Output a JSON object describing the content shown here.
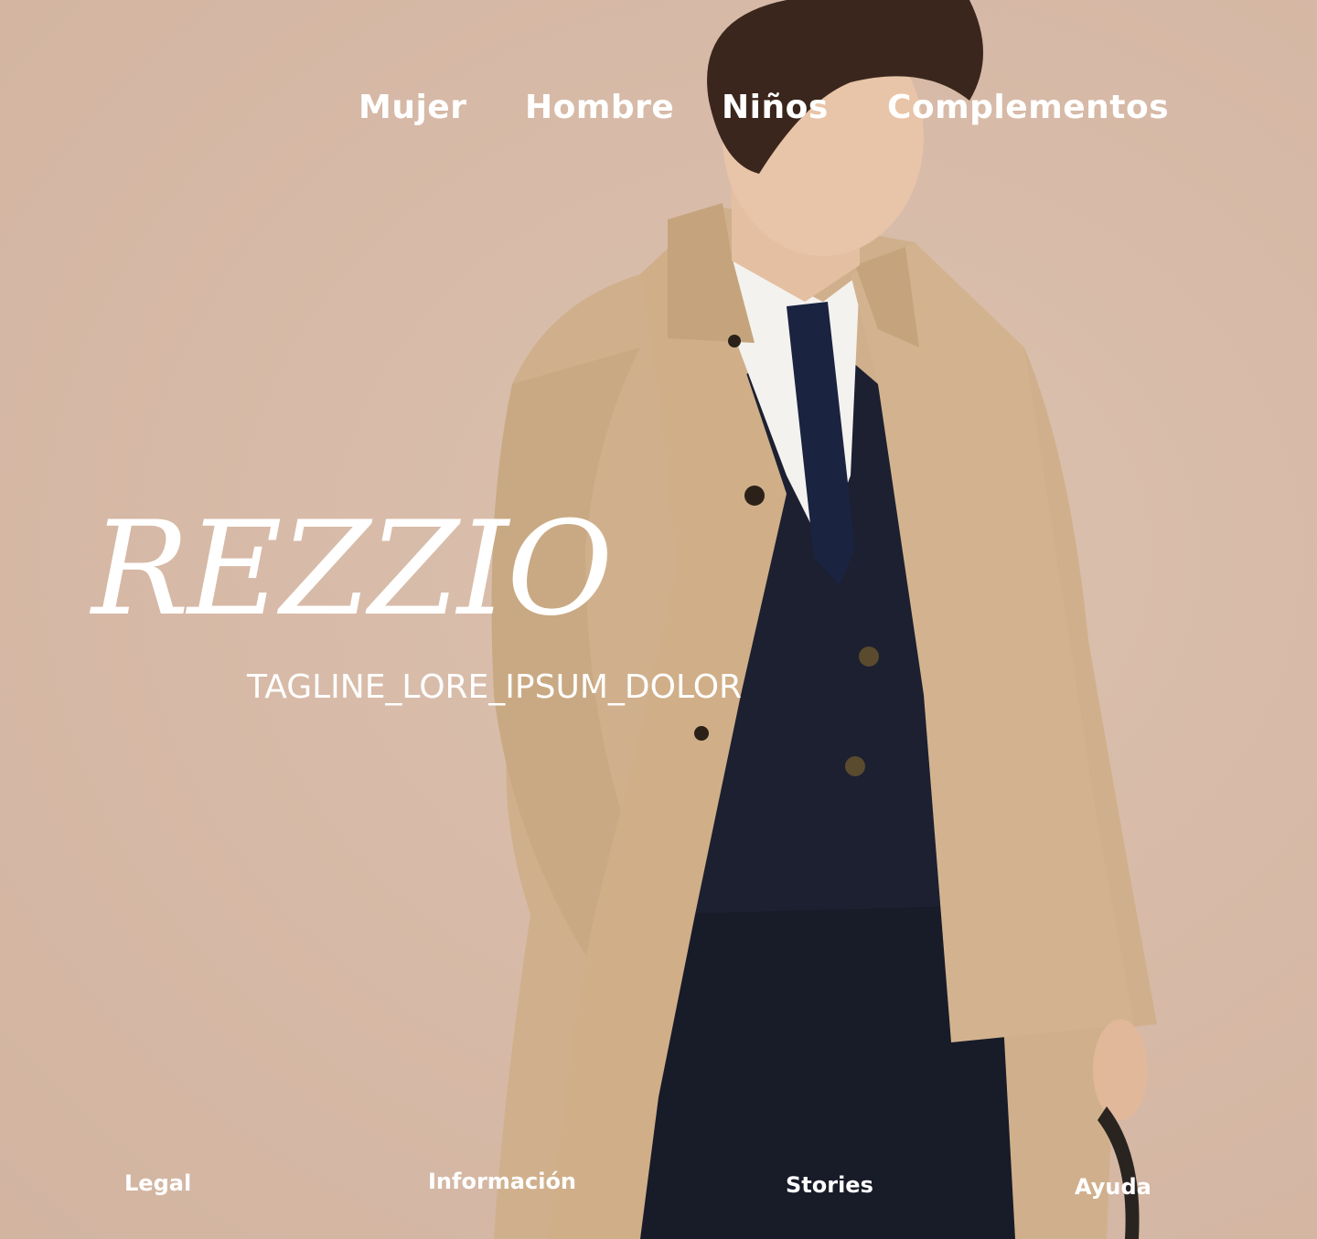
{
  "page": {
    "background_color": "#d8bca9",
    "accent_text_color": "#ffffff"
  },
  "nav": {
    "items": [
      {
        "label": "Mujer"
      },
      {
        "label": "Hombre"
      },
      {
        "label": "Niños"
      },
      {
        "label": "Complementos"
      }
    ]
  },
  "hero": {
    "brand": "REZZIO",
    "tagline": "TAGLINE_LORE_IPSUM_DOLOR",
    "image_description_icon": "model-photo"
  },
  "footer": {
    "links": [
      {
        "label": "Legal"
      },
      {
        "label": "Información"
      },
      {
        "label": "Stories"
      },
      {
        "label": "Ayuda"
      }
    ]
  }
}
